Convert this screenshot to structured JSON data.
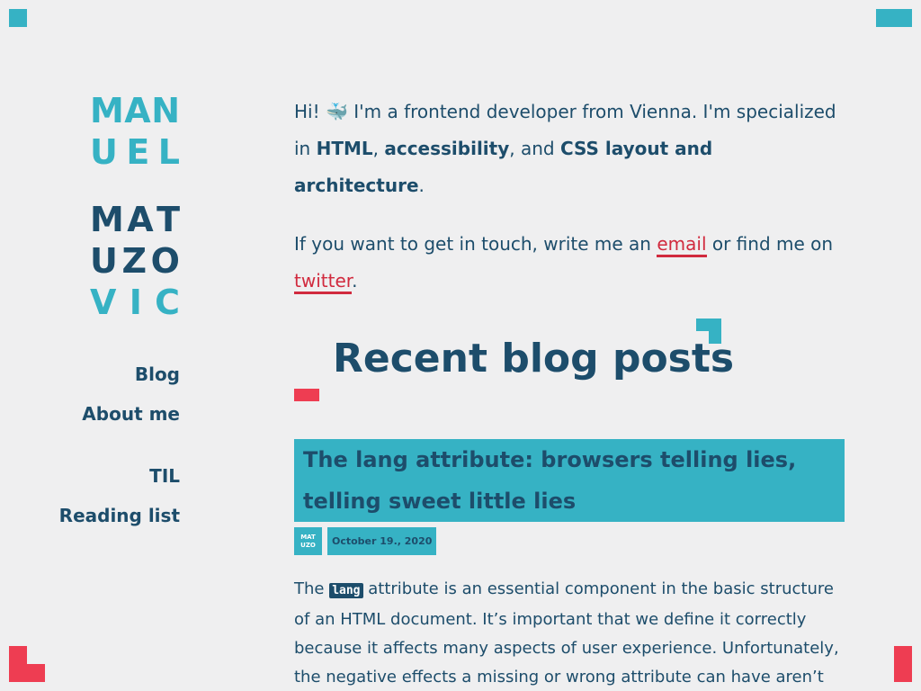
{
  "logo": {
    "row1": [
      "M",
      "A",
      "N"
    ],
    "row2": [
      "U",
      "E",
      "L"
    ],
    "row3": [
      "M",
      "A",
      "T"
    ],
    "row4": [
      "U",
      "Z",
      "O"
    ],
    "row5": [
      "V",
      "I",
      "C"
    ]
  },
  "nav": {
    "items": [
      {
        "label": "Blog"
      },
      {
        "label": "About me"
      },
      {
        "label": "TIL"
      },
      {
        "label": "Reading list"
      }
    ]
  },
  "intro": {
    "hi": "Hi! ",
    "whale": "🐳",
    "text1": " I'm a frontend developer from Vienna. I'm specialized in ",
    "html": "HTML",
    "comma1": ", ",
    "accessibility": "accessibility",
    "comma2": ", and ",
    "css": "CSS layout and architecture",
    "period": "."
  },
  "contact": {
    "text1": "If you want to get in touch, write me an ",
    "email": "email",
    "text2": " or find me on ",
    "twitter": "twitter",
    "period": "."
  },
  "section": {
    "heading": "Recent blog posts"
  },
  "post": {
    "title": "The lang attribute: browsers telling lies, telling sweet little lies",
    "meta_logo_top": "MAT",
    "meta_logo_bottom": "UZO",
    "date": "October 19., 2020",
    "body_start": "The ",
    "code": "lang",
    "body_rest": " attribute is an essential component in the basic structure of an HTML document. It’s important that we define it correctly because it affects many aspects of user experience. Unfortunately, the negative effects a missing or wrong attribute can have aren’t always evident."
  },
  "colors": {
    "navy": "#1d4d6b",
    "cyan": "#36b2c4",
    "red": "#ee3d52",
    "link": "#d12a3e",
    "background": "#efeff0"
  }
}
